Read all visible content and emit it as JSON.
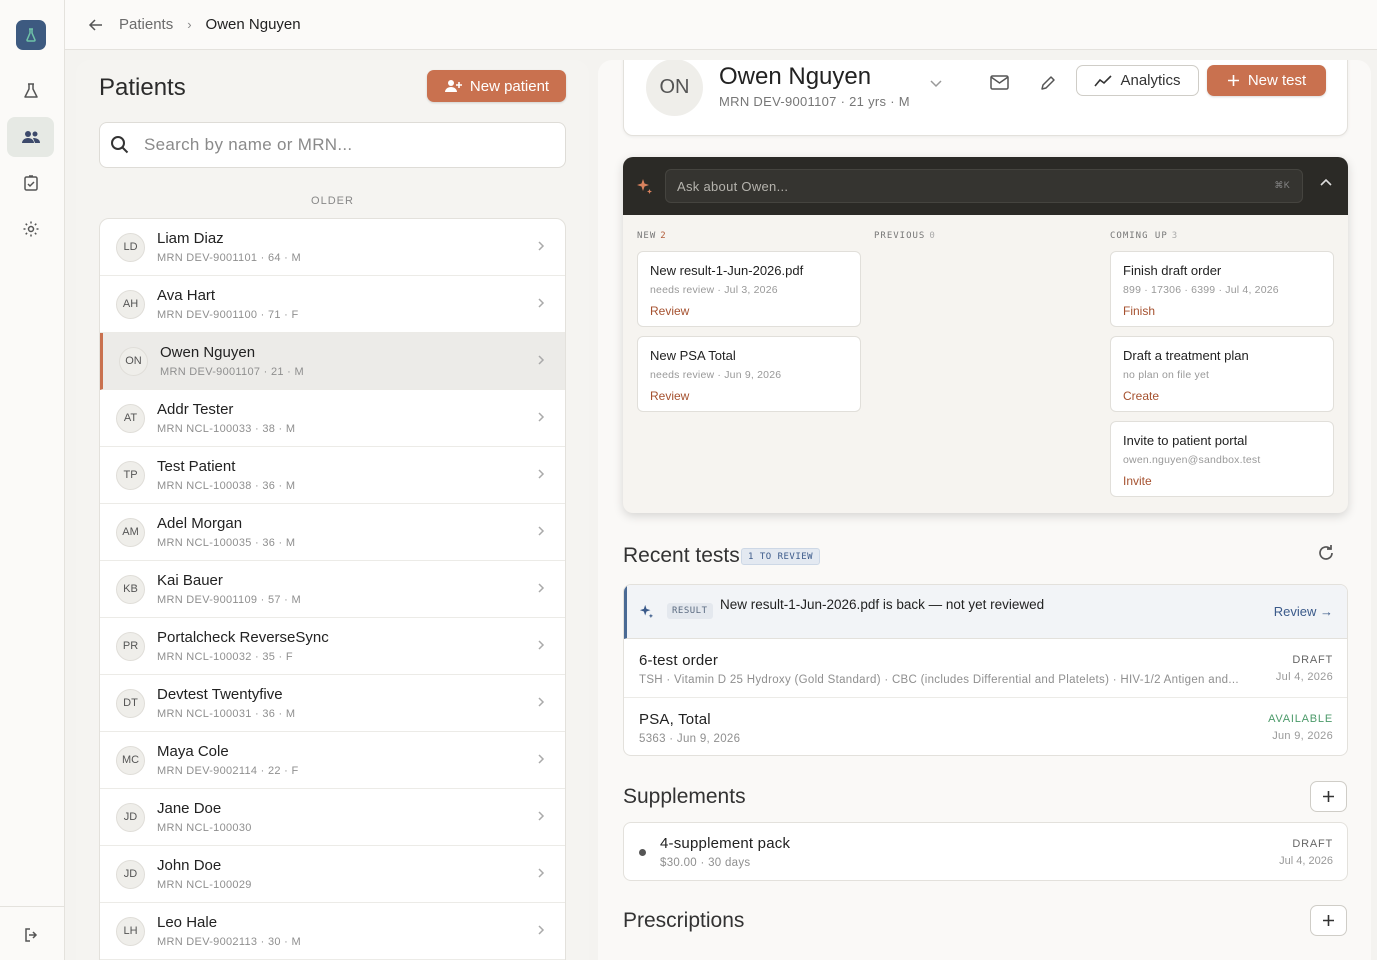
{
  "breadcrumb": {
    "parent": "Patients",
    "current": "Owen Nguyen"
  },
  "patients_panel": {
    "title": "Patients",
    "new_patient_label": "New patient",
    "search_placeholder": "Search by name or MRN...",
    "section_label": "OLDER",
    "items": [
      {
        "initials": "LD",
        "name": "Liam Diaz",
        "meta": "MRN DEV-9001101 · 64 · M"
      },
      {
        "initials": "AH",
        "name": "Ava Hart",
        "meta": "MRN DEV-9001100 · 71 · F"
      },
      {
        "initials": "ON",
        "name": "Owen Nguyen",
        "meta": "MRN DEV-9001107 · 21 · M"
      },
      {
        "initials": "AT",
        "name": "Addr Tester",
        "meta": "MRN NCL-100033 · 38 · M"
      },
      {
        "initials": "TP",
        "name": "Test Patient",
        "meta": "MRN NCL-100038 · 36 · M"
      },
      {
        "initials": "AM",
        "name": "Adel Morgan",
        "meta": "MRN NCL-100035 · 36 · M"
      },
      {
        "initials": "KB",
        "name": "Kai Bauer",
        "meta": "MRN DEV-9001109 · 57 · M"
      },
      {
        "initials": "PR",
        "name": "Portalcheck ReverseSync",
        "meta": "MRN NCL-100032 · 35 · F"
      },
      {
        "initials": "DT",
        "name": "Devtest Twentyfive",
        "meta": "MRN NCL-100031 · 36 · M"
      },
      {
        "initials": "MC",
        "name": "Maya Cole",
        "meta": "MRN DEV-9002114 · 22 · F"
      },
      {
        "initials": "JD",
        "name": "Jane Doe",
        "meta": "MRN NCL-100030"
      },
      {
        "initials": "JD",
        "name": "John Doe",
        "meta": "MRN NCL-100029"
      },
      {
        "initials": "LH",
        "name": "Leo Hale",
        "meta": "MRN DEV-9002113 · 30 · M"
      }
    ]
  },
  "patient_header": {
    "initials": "ON",
    "name": "Owen Nguyen",
    "meta": "MRN DEV-9001107  ·  21 yrs  ·  M",
    "analytics_label": "Analytics",
    "new_test_label": "New test"
  },
  "ask": {
    "placeholder": "Ask about Owen...",
    "shortcut": "⌘K",
    "columns": {
      "new": {
        "label": "NEW",
        "count": "2"
      },
      "previous": {
        "label": "PREVIOUS",
        "count": "0"
      },
      "coming_up": {
        "label": "COMING UP",
        "count": "3"
      }
    },
    "new_cards": [
      {
        "title": "New result-1-Jun-2026.pdf",
        "meta": "needs review · Jul 3, 2026",
        "action": "Review"
      },
      {
        "title": "New PSA Total",
        "meta": "needs review · Jun 9, 2026",
        "action": "Review"
      }
    ],
    "coming_cards": [
      {
        "title": "Finish draft order",
        "meta": "899 · 17306 · 6399 · Jul 4, 2026",
        "action": "Finish"
      },
      {
        "title": "Draft a treatment plan",
        "meta": "no plan on file yet",
        "action": "Create"
      },
      {
        "title": "Invite to patient portal",
        "meta": "owen.nguyen@sandbox.test",
        "action": "Invite"
      }
    ]
  },
  "recent_tests": {
    "title": "Recent tests",
    "badge": "1 TO REVIEW",
    "result_banner": {
      "badge": "RESULT",
      "text": "New result-1-Jun-2026.pdf is back — not yet reviewed",
      "action": "Review →"
    },
    "rows": [
      {
        "name": "6-test order",
        "meta": "TSH · Vitamin D 25 Hydroxy (Gold Standard) · CBC (includes Differential and Platelets) · HIV-1/2 Antigen and...",
        "status": "DRAFT",
        "date": "Jul 4, 2026"
      },
      {
        "name": "PSA, Total",
        "meta": "5363 · Jun 9, 2026",
        "status": "AVAILABLE",
        "date": "Jun 9, 2026"
      }
    ]
  },
  "supplements": {
    "title": "Supplements",
    "item": {
      "name": "4-supplement pack",
      "meta": "$30.00 · 30 days",
      "status": "DRAFT",
      "date": "Jul 4, 2026"
    }
  },
  "prescriptions": {
    "title": "Prescriptions"
  },
  "colors": {
    "accent": "#c9714f",
    "dark": "#2b2a26",
    "link_blue": "#3b5a8a",
    "available_green": "#4c9a6a"
  }
}
